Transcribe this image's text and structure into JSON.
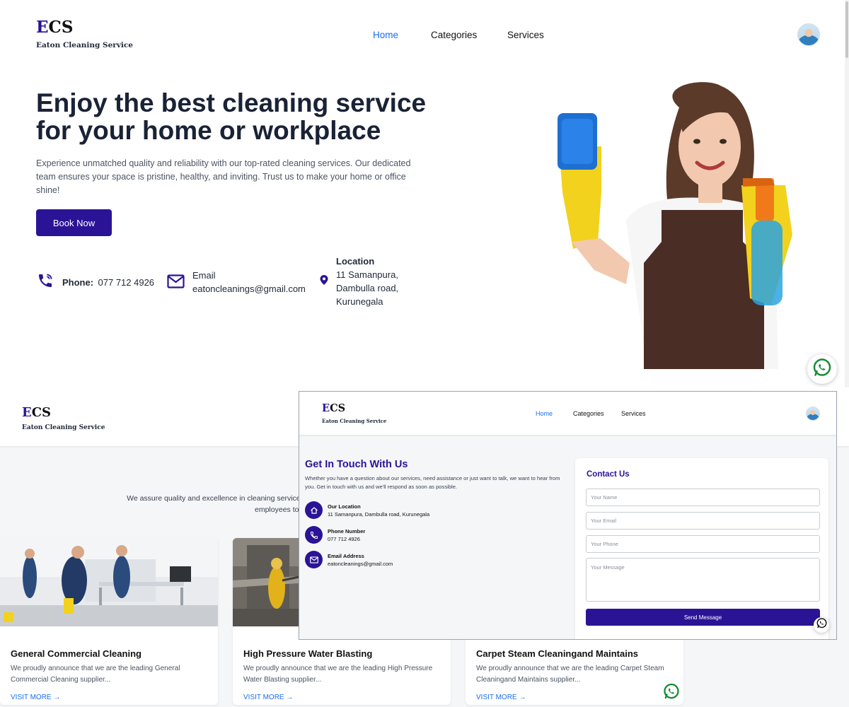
{
  "brand": {
    "first_letter": "E",
    "rest_letters": "CS",
    "subtitle": "Eaton Cleaning Service"
  },
  "nav": {
    "home": "Home",
    "categories": "Categories",
    "services": "Services"
  },
  "hero": {
    "title": "Enjoy the best cleaning service for your home or workplace",
    "description": "Experience unmatched quality and reliability with our top-rated cleaning services. Our dedicated team ensures your space is pristine, healthy, and inviting. Trust us to make your home or office shine!",
    "cta": "Book Now"
  },
  "info": {
    "phone_label": "Phone:",
    "phone_value": "077 712 4926",
    "email_label": "Email",
    "email_value": "eatoncleanings@gmail.com",
    "location_label": "Location",
    "location_line1": "11 Samanpura,",
    "location_line2": "Dambulla road,",
    "location_line3": "Kurunegala"
  },
  "services": {
    "intro_line1": "We assure quality and excellence in cleaning services and related services to keep our clie",
    "intro_line2": "employees to",
    "cards": [
      {
        "title": "General Commercial Cleaning",
        "desc": "We proudly announce that we are the leading General Commercial Cleaning supplier...",
        "link": "VISIT MORE →"
      },
      {
        "title": "High Pressure Water Blasting",
        "desc": "We proudly announce that we are the leading High Pressure Water Blasting supplier...",
        "link": "VISIT MORE →"
      },
      {
        "title": "Carpet Steam Cleaningand Maintains",
        "desc": "We proudly announce that we are the leading Carpet Steam Cleaningand Maintains supplier...",
        "link": "VISIT MORE →"
      }
    ]
  },
  "contact": {
    "heading": "Get In Touch With Us",
    "intro": "Whether you have a question about our services, need assistance or just want to talk, we want to hear from you. Get in touch with us and we'll respond as soon as possible.",
    "location_title": "Our Location",
    "location_value": "11 Samanpura, Dambulla road, Kurunegala",
    "phone_title": "Phone Number",
    "phone_value": "077 712 4926",
    "email_title": "Email Address",
    "email_value": "eatoncleanings@gmail.com",
    "form_heading": "Contact Us",
    "placeholder_name": "Your Name",
    "placeholder_email": "Your Email",
    "placeholder_phone": "Your Phone",
    "placeholder_message": "Your Message",
    "send": "Send Message"
  },
  "icons": {
    "phone": "phone-icon",
    "email": "envelope-icon",
    "location": "map-pin-icon",
    "home": "home-icon",
    "whatsapp": "whatsapp-icon"
  },
  "colors": {
    "brand": "#2b1396",
    "nav_active": "#1d6ef0",
    "whatsapp": "#128c2f"
  }
}
